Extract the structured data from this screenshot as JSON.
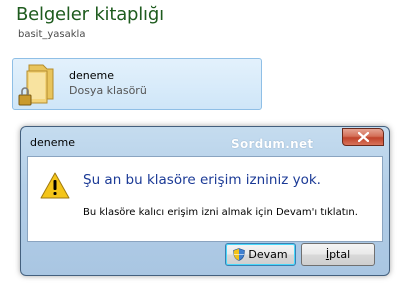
{
  "library": {
    "title": "Belgeler kitaplığı",
    "subtitle": "basit_yasakla"
  },
  "folder": {
    "name": "deneme",
    "type": "Dosya klasörü",
    "icon": "locked-folder-icon"
  },
  "dialog": {
    "title": "deneme",
    "watermark": "Sordum.net",
    "main_message": "Şu an bu klasöre erişim izniniz yok.",
    "sub_message": "Bu klasöre kalıcı erişim izni almak için Devam'ı tıklatın.",
    "continue_label": "Devam",
    "cancel_label_first": "İ",
    "cancel_label_rest": "ptal",
    "close_icon": "close-icon",
    "warning_icon": "warning-icon"
  }
}
